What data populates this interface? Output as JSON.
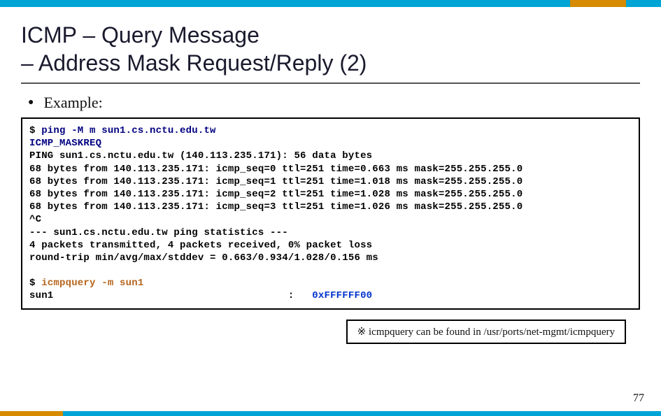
{
  "title_line1": "ICMP – Query Message",
  "title_line2": " – Address Mask Request/Reply (2)",
  "bullet1": "Example:",
  "term": {
    "prompt": "$ ",
    "cmd_ping": "ping -M m sun1.cs.nctu.edu.tw",
    "l2": "ICMP_MASKREQ",
    "l3": "PING sun1.cs.nctu.edu.tw (140.113.235.171): 56 data bytes",
    "l4": "68 bytes from 140.113.235.171: icmp_seq=0 ttl=251 time=0.663 ms mask=255.255.255.0",
    "l5": "68 bytes from 140.113.235.171: icmp_seq=1 ttl=251 time=1.018 ms mask=255.255.255.0",
    "l6": "68 bytes from 140.113.235.171: icmp_seq=2 ttl=251 time=1.028 ms mask=255.255.255.0",
    "l7": "68 bytes from 140.113.235.171: icmp_seq=3 ttl=251 time=1.026 ms mask=255.255.255.0",
    "l8": "^C",
    "l9": "--- sun1.cs.nctu.edu.tw ping statistics ---",
    "l10": "4 packets transmitted, 4 packets received, 0% packet loss",
    "l11": "round-trip min/avg/max/stddev = 0.663/0.934/1.028/0.156 ms",
    "cmd_icmpquery": "icmpquery -m sun1",
    "res_host": "sun1",
    "res_sep": "                                       :   ",
    "res_val": "0xFFFFFF00"
  },
  "note": "※ icmpquery can be found in /usr/ports/net-mgmt/icmpquery",
  "page_number": "77"
}
